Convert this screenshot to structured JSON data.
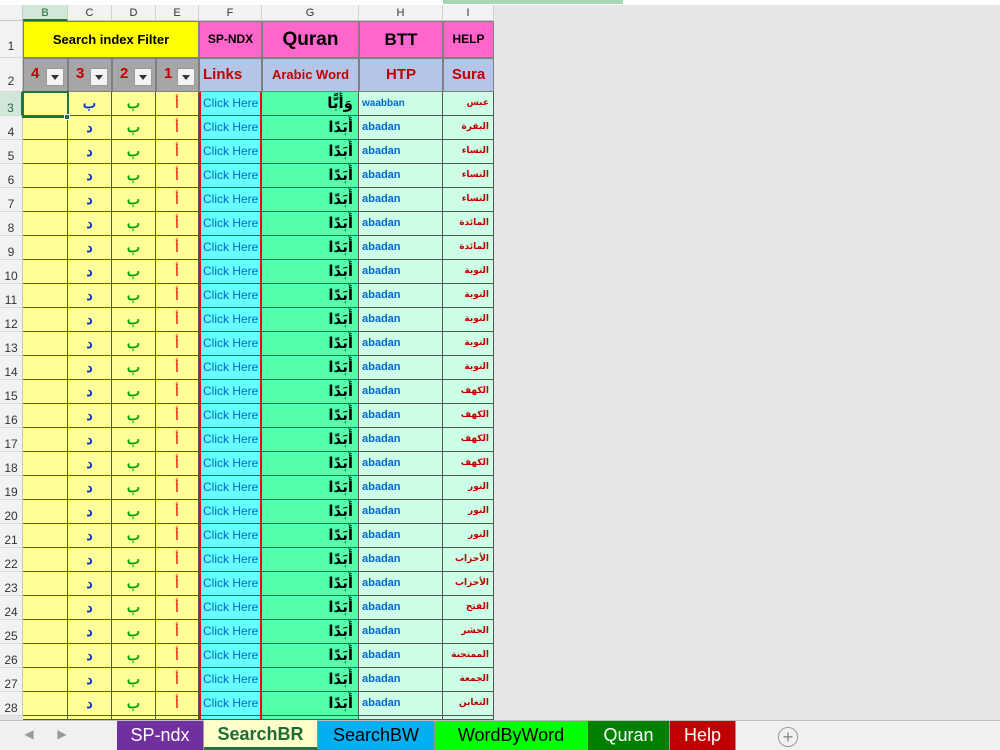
{
  "columns": [
    "B",
    "C",
    "D",
    "E",
    "F",
    "G",
    "H",
    "I"
  ],
  "row_numbers": [
    "1",
    "2",
    "3",
    "4",
    "5",
    "6",
    "7",
    "8",
    "9",
    "10",
    "11",
    "12",
    "13",
    "14",
    "15",
    "16",
    "17",
    "18",
    "19",
    "20",
    "21",
    "22",
    "23",
    "24",
    "25",
    "26",
    "27",
    "28"
  ],
  "filter": {
    "title": "Search index Filter",
    "numbers": [
      "4",
      "3",
      "2",
      "1"
    ]
  },
  "headers_row1": {
    "f": "SP-NDX",
    "g": "Quran",
    "h": "BTT",
    "i": "HELP"
  },
  "headers_row2": {
    "f": "Links",
    "g": "Arabic Word",
    "h": "HTP",
    "i": "Sura"
  },
  "rows": [
    {
      "b": "",
      "c": "ب",
      "d": "ب",
      "e": "أ",
      "f": "Click Here",
      "g": "وَأَبًّا",
      "h": "waabban",
      "i": "عبس"
    },
    {
      "b": "",
      "c": "د",
      "d": "ب",
      "e": "أ",
      "f": "Click Here",
      "g": "أَبَدًا",
      "h": "abadan",
      "i": "البقرة"
    },
    {
      "b": "",
      "c": "د",
      "d": "ب",
      "e": "أ",
      "f": "Click Here",
      "g": "أَبَدًا",
      "h": "abadan",
      "i": "النساء"
    },
    {
      "b": "",
      "c": "د",
      "d": "ب",
      "e": "أ",
      "f": "Click Here",
      "g": "أَبَدًا",
      "h": "abadan",
      "i": "النساء"
    },
    {
      "b": "",
      "c": "د",
      "d": "ب",
      "e": "أ",
      "f": "Click Here",
      "g": "أَبَدًا",
      "h": "abadan",
      "i": "النساء"
    },
    {
      "b": "",
      "c": "د",
      "d": "ب",
      "e": "أ",
      "f": "Click Here",
      "g": "أَبَدًا",
      "h": "abadan",
      "i": "المائدة"
    },
    {
      "b": "",
      "c": "د",
      "d": "ب",
      "e": "أ",
      "f": "Click Here",
      "g": "أَبَدًا",
      "h": "abadan",
      "i": "المائدة"
    },
    {
      "b": "",
      "c": "د",
      "d": "ب",
      "e": "أ",
      "f": "Click Here",
      "g": "أَبَدًا",
      "h": "abadan",
      "i": "التوبة"
    },
    {
      "b": "",
      "c": "د",
      "d": "ب",
      "e": "أ",
      "f": "Click Here",
      "g": "أَبَدًا",
      "h": "abadan",
      "i": "التوبة"
    },
    {
      "b": "",
      "c": "د",
      "d": "ب",
      "e": "أ",
      "f": "Click Here",
      "g": "أَبَدًا",
      "h": "abadan",
      "i": "التوبة"
    },
    {
      "b": "",
      "c": "د",
      "d": "ب",
      "e": "أ",
      "f": "Click Here",
      "g": "أَبَدًا",
      "h": "abadan",
      "i": "التوبة"
    },
    {
      "b": "",
      "c": "د",
      "d": "ب",
      "e": "أ",
      "f": "Click Here",
      "g": "أَبَدًا",
      "h": "abadan",
      "i": "التوبة"
    },
    {
      "b": "",
      "c": "د",
      "d": "ب",
      "e": "أ",
      "f": "Click Here",
      "g": "أَبَدًا",
      "h": "abadan",
      "i": "الكهف"
    },
    {
      "b": "",
      "c": "د",
      "d": "ب",
      "e": "أ",
      "f": "Click Here",
      "g": "أَبَدًا",
      "h": "abadan",
      "i": "الكهف"
    },
    {
      "b": "",
      "c": "د",
      "d": "ب",
      "e": "أ",
      "f": "Click Here",
      "g": "أَبَدًا",
      "h": "abadan",
      "i": "الكهف"
    },
    {
      "b": "",
      "c": "د",
      "d": "ب",
      "e": "أ",
      "f": "Click Here",
      "g": "أَبَدًا",
      "h": "abadan",
      "i": "الكهف"
    },
    {
      "b": "",
      "c": "د",
      "d": "ب",
      "e": "أ",
      "f": "Click Here",
      "g": "أَبَدًا",
      "h": "abadan",
      "i": "النور"
    },
    {
      "b": "",
      "c": "د",
      "d": "ب",
      "e": "أ",
      "f": "Click Here",
      "g": "أَبَدًا",
      "h": "abadan",
      "i": "النور"
    },
    {
      "b": "",
      "c": "د",
      "d": "ب",
      "e": "أ",
      "f": "Click Here",
      "g": "أَبَدًا",
      "h": "abadan",
      "i": "النور"
    },
    {
      "b": "",
      "c": "د",
      "d": "ب",
      "e": "أ",
      "f": "Click Here",
      "g": "أَبَدًا",
      "h": "abadan",
      "i": "الأحزاب"
    },
    {
      "b": "",
      "c": "د",
      "d": "ب",
      "e": "أ",
      "f": "Click Here",
      "g": "أَبَدًا",
      "h": "abadan",
      "i": "الأحزاب"
    },
    {
      "b": "",
      "c": "د",
      "d": "ب",
      "e": "أ",
      "f": "Click Here",
      "g": "أَبَدًا",
      "h": "abadan",
      "i": "الفتح"
    },
    {
      "b": "",
      "c": "د",
      "d": "ب",
      "e": "أ",
      "f": "Click Here",
      "g": "أَبَدًا",
      "h": "abadan",
      "i": "الحشر"
    },
    {
      "b": "",
      "c": "د",
      "d": "ب",
      "e": "أ",
      "f": "Click Here",
      "g": "أَبَدًا",
      "h": "abadan",
      "i": "الممتحنة"
    },
    {
      "b": "",
      "c": "د",
      "d": "ب",
      "e": "أ",
      "f": "Click Here",
      "g": "أَبَدًا",
      "h": "abadan",
      "i": "الجمعة"
    },
    {
      "b": "",
      "c": "د",
      "d": "ب",
      "e": "أ",
      "f": "Click Here",
      "g": "أَبَدًا",
      "h": "abadan",
      "i": "التغابن"
    }
  ],
  "sheet_tabs": [
    {
      "label": "SP-ndx",
      "bg": "#7030a0",
      "color": "#ffffff"
    },
    {
      "label": "SearchBR",
      "bg": "#ffffcc",
      "color": "#1f6b38",
      "active": true
    },
    {
      "label": "SearchBW",
      "bg": "#00b0f0",
      "color": "#000000"
    },
    {
      "label": "WordByWord",
      "bg": "#00ff00",
      "color": "#000000"
    },
    {
      "label": "Quran",
      "bg": "#008000",
      "color": "#ffffff"
    },
    {
      "label": "Help",
      "bg": "#c00000",
      "color": "#ffffff"
    }
  ],
  "icons": {
    "prev_sheet": "triangle-left-icon",
    "next_sheet": "triangle-right-icon",
    "new_sheet": "plus-circle-icon",
    "filter_dropdown": "chevron-down-icon"
  }
}
